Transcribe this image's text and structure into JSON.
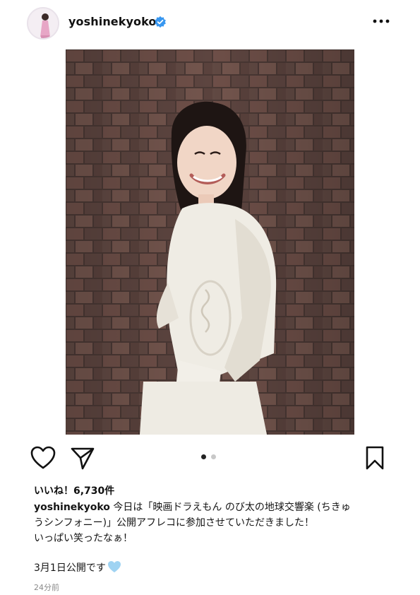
{
  "header": {
    "username": "yoshinekyoko",
    "verified_color": "#3897f0"
  },
  "post": {
    "image_subject": "woman in white blouse smiling in front of brick wall",
    "carousel": {
      "index": 1,
      "total": 2
    }
  },
  "actions": {
    "like_icon": "heart-icon",
    "share_icon": "paper-plane-icon",
    "save_icon": "bookmark-icon"
  },
  "likes": "いいね！6,730件",
  "caption": {
    "user": "yoshinekyoko",
    "line1": " 今日は「映画ドラえもん のび太の地球交響楽 (ちきゅ",
    "line2": "うシンフォニー)」公開アフレコに参加させていただきました！",
    "line3": "いっぱい笑ったなぁ！",
    "release": "3月1日公開です",
    "emoji": "light-blue-heart"
  },
  "timestamp": "24分前"
}
